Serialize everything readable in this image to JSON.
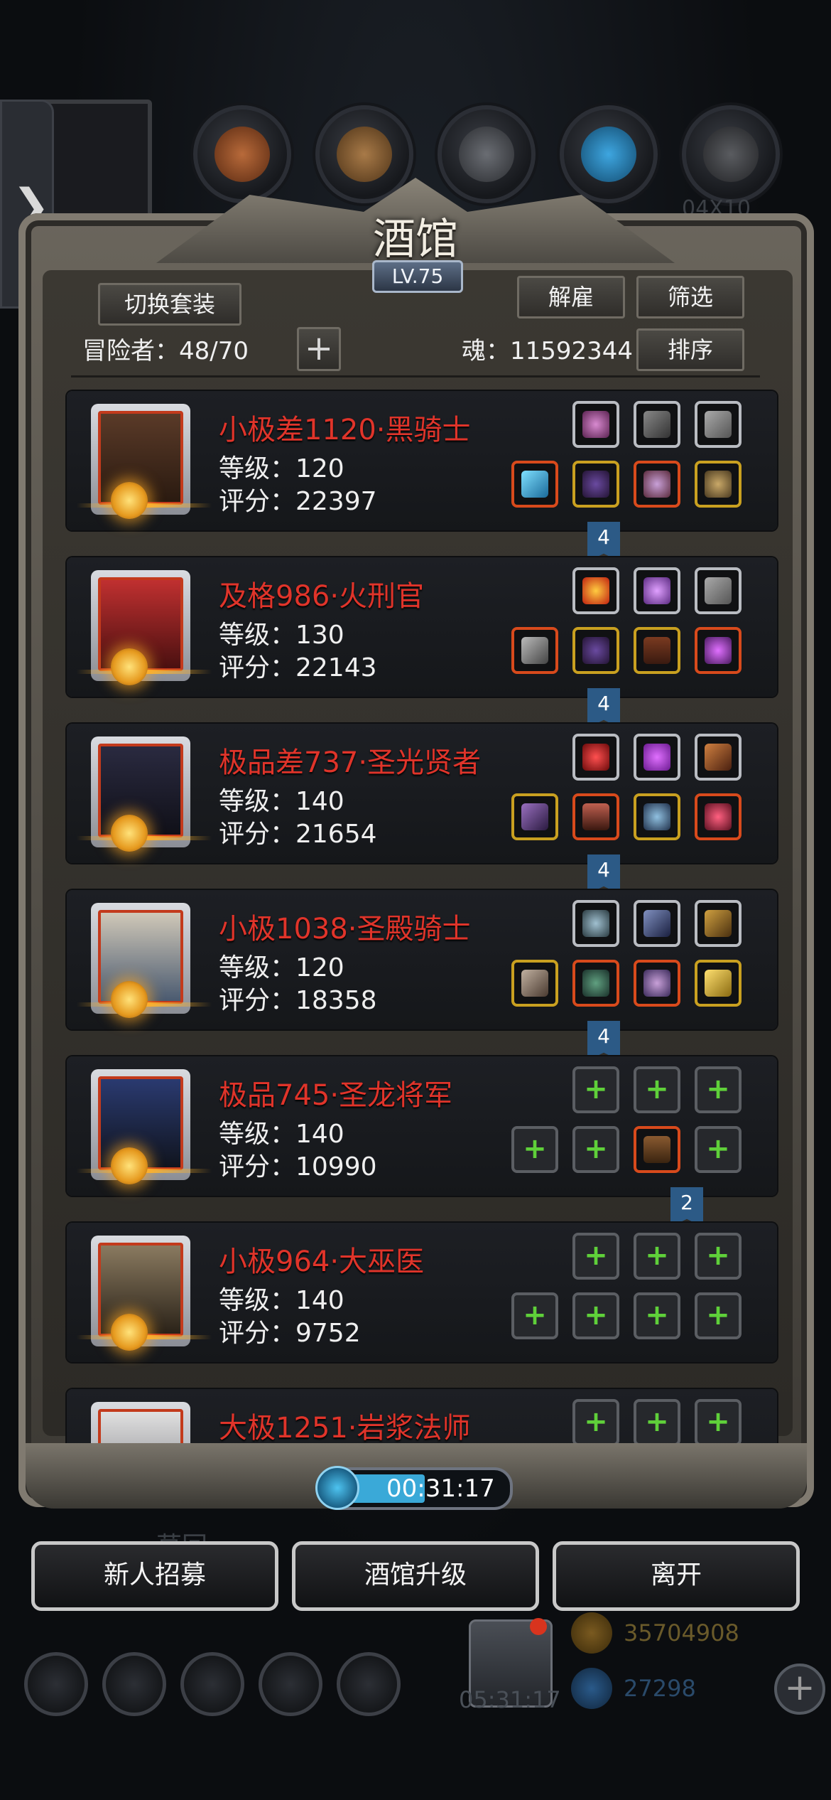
{
  "window": {
    "title": "酒馆",
    "level": "LV.75"
  },
  "side_tab": {
    "glyph": "❯"
  },
  "header": {
    "switch_outfit": "切换套装",
    "dismiss": "解雇",
    "filter": "筛选",
    "sort": "排序",
    "adventurers_label": "冒险者：48/70",
    "soul_label": "魂：11592344",
    "add": "+"
  },
  "heroes": [
    {
      "name": "小极差1120·黑骑士",
      "level": "等级：120",
      "score": "评分：22397",
      "badge": "4"
    },
    {
      "name": "及格986·火刑官",
      "level": "等级：130",
      "score": "评分：22143",
      "badge": "4"
    },
    {
      "name": "极品差737·圣光贤者",
      "level": "等级：140",
      "score": "评分：21654",
      "badge": "4"
    },
    {
      "name": "小极1038·圣殿骑士",
      "level": "等级：120",
      "score": "评分：18358",
      "badge": "4"
    },
    {
      "name": "极品745·圣龙将军",
      "level": "等级：140",
      "score": "评分：10990",
      "badge": "2"
    },
    {
      "name": "小极964·大巫医",
      "level": "等级：140",
      "score": "评分：9752",
      "badge": ""
    },
    {
      "name": "大极1251·岩浆法师",
      "level": "",
      "score": "",
      "badge": ""
    }
  ],
  "timer": {
    "value": "00:31:17"
  },
  "ghost_label": "草回",
  "actions": {
    "recruit": "新人招募",
    "upgrade": "酒馆升级",
    "leave": "离开"
  },
  "bottom_bar": {
    "chest_timer": "05:31:17",
    "gold": "35704908",
    "gems": "27298",
    "plus": "+",
    "top_right_ghost": "04X10"
  },
  "colors": {
    "hero_name": "#e0342a",
    "ribbon": "#2c5a86",
    "timer_fill": "#3aa9d8",
    "empty_plus": "#5fd03a"
  }
}
